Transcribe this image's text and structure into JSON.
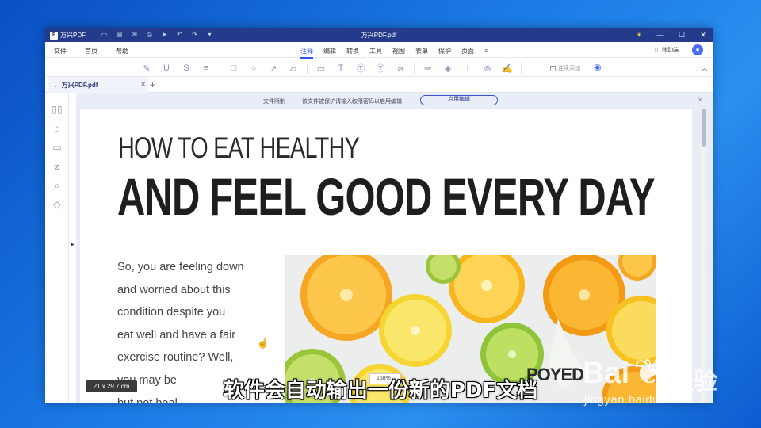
{
  "app": {
    "brand": "万兴PDF",
    "window_title": "万兴PDF.pdf"
  },
  "menubar": {
    "left": [
      "文件",
      "首页",
      "帮助"
    ],
    "center": [
      "注释",
      "编辑",
      "转换",
      "工具",
      "视图",
      "表单",
      "保护",
      "页面"
    ],
    "active_tab": "注释",
    "mobile_label": "移动端"
  },
  "toolbar": {
    "continuous_add": "连续添加"
  },
  "tab": {
    "doc_name": "万兴PDF.pdf"
  },
  "notice": {
    "restriction": "文件限制",
    "message": "该文件被保护请输入权限密码以启用编辑",
    "enable_button": "启用编辑"
  },
  "document": {
    "heading_line1": "HOW TO EAT HEALTHY",
    "heading_line2": "AND FEEL GOOD EVERY DAY",
    "body_lines": [
      "So, you are feeling down",
      "and worried about this",
      "condition despite you",
      "eat well and have a fair",
      "exercise routine? Well,",
      "you may be",
      "but not heal"
    ],
    "image_text": "POYED"
  },
  "status": {
    "page_size": "21 x 29.7 cm",
    "zoom": "158%"
  },
  "overlay": {
    "caption": "软件会自动输出一份新的PDF文档",
    "watermark_brand": "Bai",
    "watermark_suffix": "经验",
    "watermark_url": "jingyan.baidu.com"
  },
  "colors": {
    "titlebar": "#243a8a",
    "accent": "#2f54eb",
    "desktop": "#1b7be6"
  }
}
